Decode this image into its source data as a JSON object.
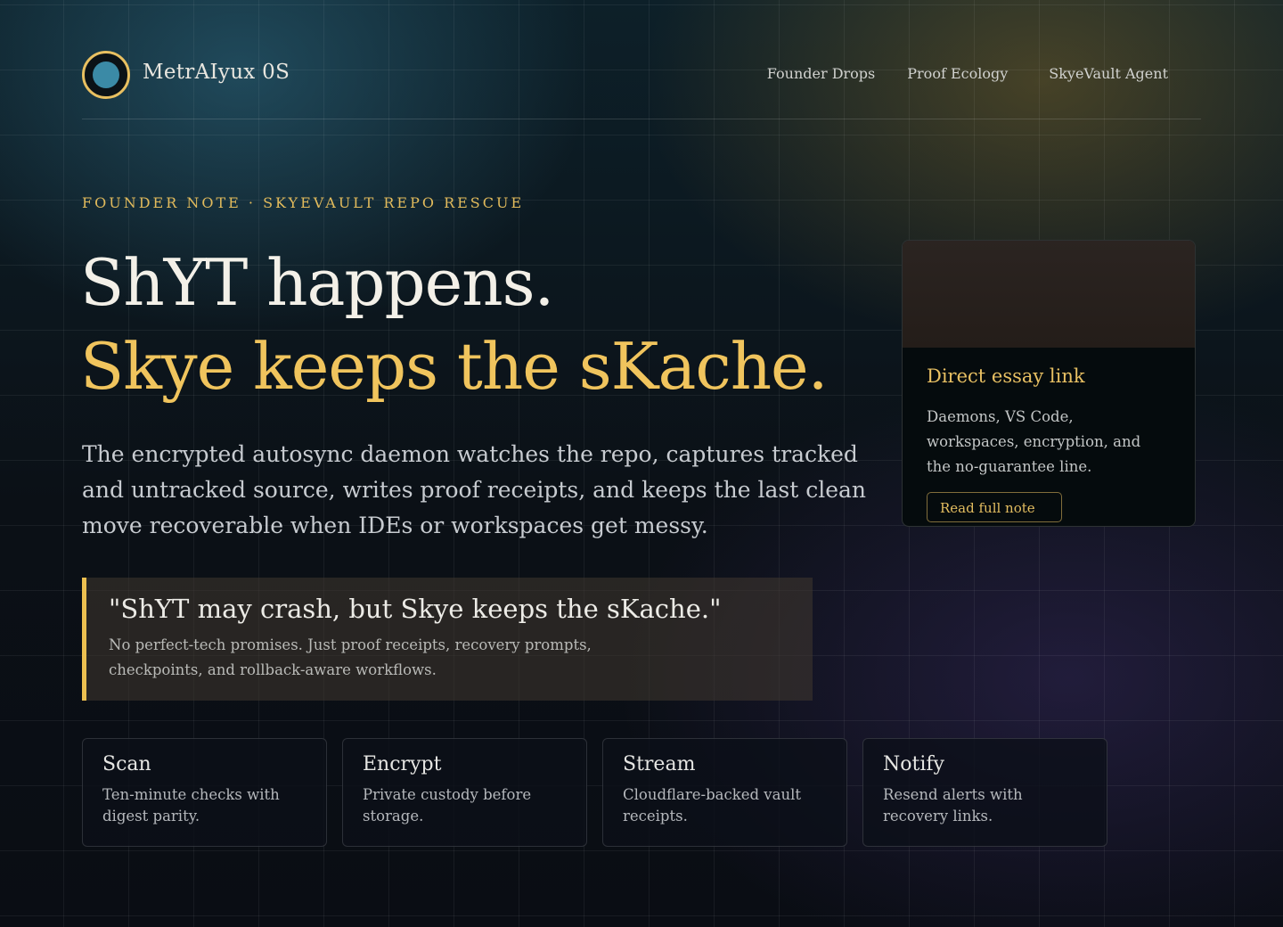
{
  "brand": {
    "name": "MetrAIyux 0S"
  },
  "nav": {
    "items": [
      "Founder Drops",
      "Proof Ecology",
      "SkyeVault Agent"
    ]
  },
  "hero": {
    "eyebrow": "FOUNDER NOTE · SKYEVAULT REPO RESCUE",
    "title_line1": "ShYT happens.",
    "title_line2": "Skye keeps the sKache.",
    "lede": "The encrypted autosync daemon watches the repo, captures tracked and untracked source, writes proof receipts, and keeps the last clean move recoverable when IDEs or workspaces get messy."
  },
  "quote": {
    "text": "\"ShYT may crash, but Skye keeps the sKache.\"",
    "sub": "No perfect-tech promises. Just proof receipts, recovery prompts, checkpoints, and rollback-aware workflows."
  },
  "card": {
    "title": "Direct essay link",
    "desc": "Daemons, VS Code, workspaces, encryption, and the no-guarantee line.",
    "button": "Read full note"
  },
  "features": [
    {
      "title": "Scan",
      "desc": "Ten-minute checks with digest parity."
    },
    {
      "title": "Encrypt",
      "desc": "Private custody before storage."
    },
    {
      "title": "Stream",
      "desc": "Cloudflare-backed vault receipts."
    },
    {
      "title": "Notify",
      "desc": "Resend alerts with recovery links."
    }
  ],
  "colors": {
    "accent": "#f0c45d",
    "logo_core": "#3b8aa6",
    "text": "#f3f0e8"
  }
}
